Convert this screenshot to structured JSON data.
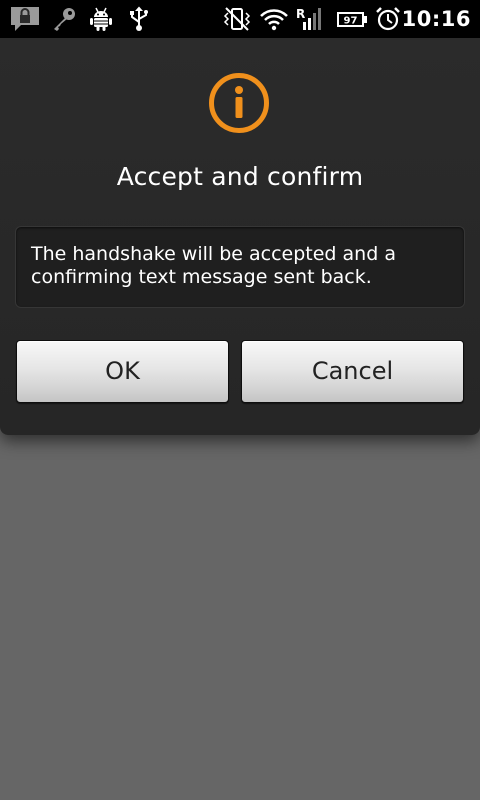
{
  "status_bar": {
    "time": "10:16",
    "battery_level": "97",
    "icons": [
      "notification-lock-icon",
      "key-icon",
      "android-debug-icon",
      "usb-icon",
      "vibrate-off-icon",
      "wifi-icon",
      "signal-roaming-icon",
      "battery-icon",
      "alarm-icon"
    ]
  },
  "dialog": {
    "icon": "info-icon",
    "accent_color": "#f0901c",
    "title": "Accept and confirm",
    "message": "The handshake will be accepted and a confirming text message sent back.",
    "buttons": {
      "ok_label": "OK",
      "cancel_label": "Cancel"
    }
  }
}
